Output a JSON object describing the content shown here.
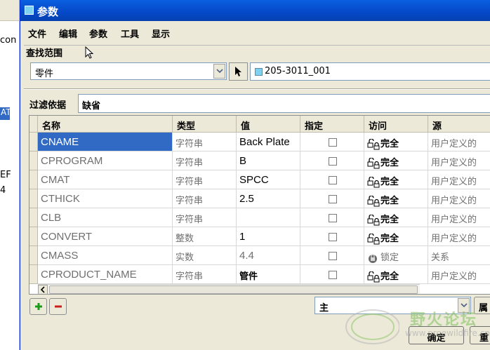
{
  "background_left": {
    "items": [
      "con",
      "AT",
      "EF",
      "4"
    ]
  },
  "window": {
    "title": "参数"
  },
  "menu": {
    "items": [
      "文件",
      "编辑",
      "参数",
      "工具",
      "显示"
    ]
  },
  "lookup": {
    "label": "查找范围",
    "scope_value": "零件",
    "model_name": "205-3011_001"
  },
  "filter": {
    "label": "过滤依据",
    "value": "缺省"
  },
  "table": {
    "columns": [
      "名称",
      "类型",
      "值",
      "指定",
      "访问",
      "源"
    ],
    "rows": [
      {
        "name": "CNAME",
        "type": "字符串",
        "value": "Back Plate",
        "designate": false,
        "access": "完全",
        "source": "用户定义的",
        "selected": true
      },
      {
        "name": "CPROGRAM",
        "type": "字符串",
        "value": "B",
        "designate": false,
        "access": "完全",
        "source": "用户定义的"
      },
      {
        "name": "CMAT",
        "type": "字符串",
        "value": "SPCC",
        "designate": false,
        "access": "完全",
        "source": "用户定义的"
      },
      {
        "name": "CTHICK",
        "type": "字符串",
        "value": "2.5",
        "designate": false,
        "access": "完全",
        "source": "用户定义的"
      },
      {
        "name": "CLB",
        "type": "字符串",
        "value": "",
        "designate": false,
        "access": "完全",
        "source": "用户定义的"
      },
      {
        "name": "CONVERT",
        "type": "整数",
        "value": "1",
        "designate": false,
        "access": "完全",
        "source": "用户定义的"
      },
      {
        "name": "CMASS",
        "type": "实数",
        "value": "4.4",
        "designate": false,
        "access": "锁定",
        "source": "关系",
        "locked": true
      },
      {
        "name": "CPRODUCT_NAME",
        "type": "字符串",
        "value": "管件",
        "designate": false,
        "access": "完全",
        "source": "用户定义的"
      }
    ]
  },
  "bottom": {
    "add_label": "+",
    "remove_label": "−",
    "combo_value": "主",
    "properties_label": "属性",
    "ok_label": "确定",
    "reset_label": "重置"
  },
  "watermark": {
    "text": "野火论坛",
    "url": "www.proewildfire.cn"
  },
  "colors": {
    "titlebar": "#0548c8",
    "selection": "#316ac5",
    "add_green": "#1a9a1a",
    "remove_red": "#c81e1e"
  }
}
